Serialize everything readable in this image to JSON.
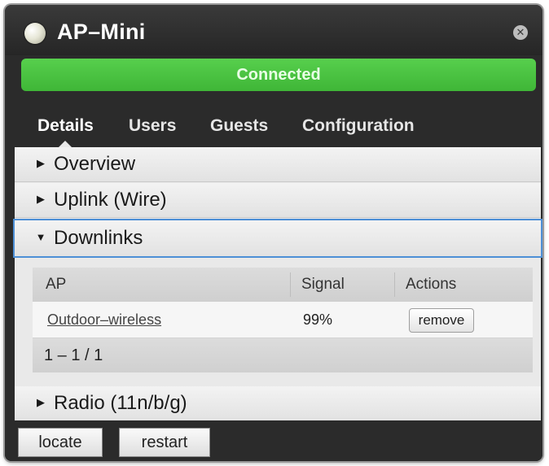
{
  "window": {
    "title": "AP–Mini",
    "status": "Connected"
  },
  "tabs": [
    {
      "label": "Details"
    },
    {
      "label": "Users"
    },
    {
      "label": "Guests"
    },
    {
      "label": "Configuration"
    }
  ],
  "sections": {
    "overview": "Overview",
    "uplink": "Uplink (Wire)",
    "downlinks": "Downlinks",
    "radio": "Radio (11n/b/g)"
  },
  "downlinks_table": {
    "headers": {
      "ap": "AP",
      "signal": "Signal",
      "actions": "Actions"
    },
    "rows": [
      {
        "ap": "Outdoor–wireless",
        "signal": "99%",
        "action": "remove"
      }
    ],
    "pagination": "1 – 1 / 1"
  },
  "footer": {
    "locate": "locate",
    "restart": "restart"
  },
  "colors": {
    "connected": "#45bd3c",
    "window": "#2b2b2b",
    "selection": "#4d8fd6"
  }
}
